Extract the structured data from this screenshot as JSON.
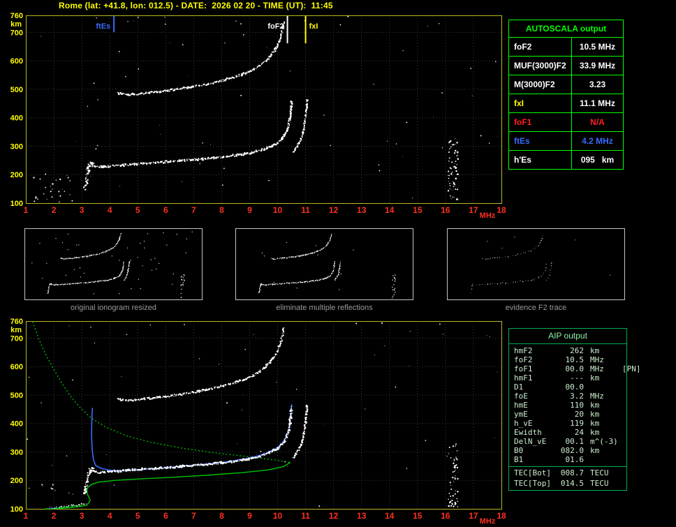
{
  "title": "Rome (lat: +41.8, lon: 012.5) - DATE:  2026 02 20 - TIME (UT):  11:45",
  "colors": {
    "background": "#000000",
    "frame": "#b9b920",
    "grid": "#3c3c3c",
    "x_label": "#ff3020",
    "y_label": "#ffff00",
    "trace": "#ffffff",
    "profile_green": "#00c400",
    "fit_blue": "#3b6bff",
    "es_green": "#00dd44",
    "table_green": "#00ff00",
    "aip_border": "#00b050",
    "aip_text": "#cdeccd",
    "caption_gray": "#9a9a9a",
    "red": "#ff2020",
    "yellow": "#ffff00"
  },
  "axis": {
    "x_ticks": [
      1,
      2,
      3,
      4,
      5,
      6,
      7,
      8,
      9,
      10,
      11,
      12,
      13,
      14,
      15,
      16,
      17,
      18
    ],
    "y_ticks": [
      760,
      700,
      600,
      500,
      400,
      300,
      200,
      100
    ],
    "x_unit": "MHz",
    "y_unit": "km"
  },
  "autoscala": {
    "title": "AUTOSCALA output",
    "rows": [
      {
        "label": "foF2",
        "value": "10.5 MHz",
        "label_color": "#ffffff",
        "value_color": "#ffffff"
      },
      {
        "label": "MUF(3000)F2",
        "value": "33.9 MHz",
        "label_color": "#ffffff",
        "value_color": "#ffffff"
      },
      {
        "label": "M(3000)F2",
        "value": "3.23",
        "label_color": "#ffffff",
        "value_color": "#ffffff"
      },
      {
        "label": "fxI",
        "value": "11.1 MHz",
        "label_color": "#ffff00",
        "value_color": "#ffffff"
      },
      {
        "label": "foF1",
        "value": "N/A",
        "label_color": "#ff2020",
        "value_color": "#ff2020"
      },
      {
        "label": "ftEs",
        "value": "4.2 MHz",
        "label_color": "#3b6bff",
        "value_color": "#3b6bff"
      },
      {
        "label": "h'Es",
        "value": "095   km",
        "label_color": "#ffffff",
        "value_color": "#ffffff"
      }
    ]
  },
  "aip": {
    "title": "AIP output",
    "rows": [
      {
        "label": "hmF2",
        "value": "262",
        "unit": "km",
        "extra": ""
      },
      {
        "label": "foF2",
        "value": "10.5",
        "unit": "MHz",
        "extra": ""
      },
      {
        "label": "foF1",
        "value": "00.0",
        "unit": "MHz",
        "extra": "[PN]"
      },
      {
        "label": "hmF1",
        "value": "---",
        "unit": "km",
        "extra": ""
      },
      {
        "label": "D1",
        "value": "00.0",
        "unit": "",
        "extra": ""
      },
      {
        "label": "foE",
        "value": "3.2",
        "unit": "MHz",
        "extra": ""
      },
      {
        "label": "hmE",
        "value": "110",
        "unit": "km",
        "extra": ""
      },
      {
        "label": "ymE",
        "value": "20",
        "unit": "km",
        "extra": ""
      },
      {
        "label": "h_vE",
        "value": "119",
        "unit": "km",
        "extra": ""
      },
      {
        "label": "Ewidth",
        "value": "24",
        "unit": "km",
        "extra": ""
      },
      {
        "label": "DelN_vE",
        "value": "00.1",
        "unit": "m^(-3)",
        "extra": ""
      },
      {
        "label": "B0",
        "value": "082.0",
        "unit": "km",
        "extra": ""
      },
      {
        "label": "B1",
        "value": "01.6",
        "unit": "",
        "extra": ""
      },
      {
        "label": "TEC[Bot]",
        "value": "008.7",
        "unit": "TECU",
        "extra": "",
        "sep": true
      },
      {
        "label": "TEC[Top]",
        "value": "014.5",
        "unit": "TECU",
        "extra": ""
      }
    ]
  },
  "thumbs": [
    {
      "caption": "original ionogram resized",
      "noise_specks": 45,
      "band": true,
      "step": 1.7,
      "passes": 2,
      "color": "#ffffff"
    },
    {
      "caption": "eliminate multiple reflections",
      "noise_specks": 10,
      "band": true,
      "step": 1.7,
      "passes": 2,
      "color": "#ffffff"
    },
    {
      "caption": "evidence F2 trace",
      "noise_specks": 6,
      "band": false,
      "step": 3.4,
      "passes": 1,
      "color": "#b9b9b9"
    }
  ],
  "markers": [
    {
      "f": 4.15,
      "len": 24,
      "side": "left",
      "label": "ftEs",
      "color": "#3b6bff"
    },
    {
      "f": 10.35,
      "len": 40,
      "side": "left",
      "label": "foF2",
      "color": "#ffffff"
    },
    {
      "f": 11.0,
      "len": 40,
      "side": "right",
      "label": "fxI",
      "color": "#ffff00"
    }
  ],
  "traces": {
    "hop1": [
      [
        3.3,
        232
      ],
      [
        3.6,
        228
      ],
      [
        4,
        230
      ],
      [
        4.5,
        234
      ],
      [
        5,
        238
      ],
      [
        5.5,
        241
      ],
      [
        6,
        245
      ],
      [
        6.5,
        249
      ],
      [
        7,
        253
      ],
      [
        7.5,
        257
      ],
      [
        8,
        262
      ],
      [
        8.5,
        268
      ],
      [
        9,
        276
      ],
      [
        9.4,
        286
      ],
      [
        9.7,
        297
      ],
      [
        10,
        312
      ],
      [
        10.15,
        326
      ],
      [
        10.28,
        344
      ],
      [
        10.38,
        368
      ],
      [
        10.44,
        398
      ],
      [
        10.48,
        432
      ],
      [
        10.5,
        462
      ]
    ],
    "cusp": [
      [
        3.12,
        152
      ],
      [
        3.18,
        185
      ],
      [
        3.22,
        215
      ],
      [
        3.3,
        242
      ],
      [
        3.5,
        236
      ]
    ],
    "hop2": [
      [
        4.3,
        487
      ],
      [
        4.6,
        480
      ],
      [
        5,
        484
      ],
      [
        5.5,
        489
      ],
      [
        6,
        495
      ],
      [
        6.5,
        502
      ],
      [
        7,
        510
      ],
      [
        7.5,
        519
      ],
      [
        8,
        530
      ],
      [
        8.5,
        544
      ],
      [
        9,
        562
      ],
      [
        9.4,
        585
      ],
      [
        9.7,
        612
      ],
      [
        9.95,
        645
      ],
      [
        10.1,
        680
      ],
      [
        10.18,
        712
      ],
      [
        10.24,
        740
      ]
    ],
    "xmode": [
      [
        10.55,
        278
      ],
      [
        10.7,
        298
      ],
      [
        10.85,
        328
      ],
      [
        10.95,
        368
      ],
      [
        11.02,
        418
      ],
      [
        11.06,
        468
      ]
    ],
    "profile_top": [
      [
        1.25,
        758
      ],
      [
        1.45,
        700
      ],
      [
        1.7,
        645
      ],
      [
        2,
        590
      ],
      [
        2.3,
        540
      ],
      [
        2.6,
        495
      ],
      [
        2.95,
        455
      ],
      [
        3.35,
        418
      ],
      [
        3.9,
        385
      ],
      [
        4.6,
        357
      ],
      [
        5.5,
        333
      ],
      [
        6.6,
        313
      ],
      [
        7.8,
        296
      ],
      [
        9,
        283
      ],
      [
        9.9,
        272
      ],
      [
        10.45,
        263
      ]
    ],
    "profile_bottom": [
      [
        10.45,
        263
      ],
      [
        10.2,
        248
      ],
      [
        9.6,
        236
      ],
      [
        8.7,
        227
      ],
      [
        7.6,
        219
      ],
      [
        6.4,
        212
      ],
      [
        5.2,
        206
      ],
      [
        4.2,
        200
      ],
      [
        3.6,
        194
      ],
      [
        3.35,
        186
      ],
      [
        3.22,
        176
      ],
      [
        3.18,
        165
      ],
      [
        3.2,
        152
      ],
      [
        3.26,
        140
      ],
      [
        3.3,
        130
      ],
      [
        3.24,
        120
      ],
      [
        3.18,
        113
      ],
      [
        2.9,
        108
      ],
      [
        2.5,
        104
      ],
      [
        2.1,
        101
      ],
      [
        1.7,
        100
      ]
    ],
    "blue_fit": [
      [
        3.38,
        455
      ],
      [
        3.36,
        410
      ],
      [
        3.35,
        360
      ],
      [
        3.37,
        310
      ],
      [
        3.42,
        272
      ],
      [
        3.5,
        252
      ],
      [
        3.7,
        242
      ],
      [
        4,
        236
      ],
      [
        4.5,
        234
      ],
      [
        5,
        237
      ],
      [
        5.5,
        241
      ],
      [
        6,
        245
      ],
      [
        6.5,
        249
      ],
      [
        7,
        253
      ],
      [
        7.5,
        258
      ],
      [
        8,
        263
      ],
      [
        8.5,
        270
      ],
      [
        9,
        279
      ],
      [
        9.4,
        289
      ],
      [
        9.7,
        301
      ],
      [
        10,
        316
      ],
      [
        10.15,
        330
      ],
      [
        10.28,
        348
      ],
      [
        10.38,
        372
      ],
      [
        10.44,
        402
      ],
      [
        10.48,
        436
      ],
      [
        10.5,
        468
      ]
    ],
    "e_white": [
      [
        2.05,
        104
      ],
      [
        2.3,
        107
      ],
      [
        2.55,
        110
      ],
      [
        2.8,
        113
      ],
      [
        3.05,
        116
      ],
      [
        3.25,
        119
      ]
    ],
    "e_green": [
      [
        2.1,
        102
      ],
      [
        2.35,
        105
      ],
      [
        2.6,
        108
      ],
      [
        2.85,
        111
      ],
      [
        3.1,
        114
      ]
    ],
    "e_blue": [
      [
        1.85,
        101
      ],
      [
        2,
        103
      ],
      [
        2.15,
        105
      ]
    ]
  },
  "noise": {
    "top": [
      {
        "x": [
          16.1,
          16.45
        ],
        "y": [
          100,
          330
        ],
        "n": 70,
        "r": 1.1
      },
      {
        "x": [
          1.1,
          2.7
        ],
        "y": [
          100,
          205
        ],
        "n": 26,
        "r": 1.0
      },
      {
        "x": [
          1.05,
          17.9
        ],
        "y": [
          105,
          755
        ],
        "n": 55,
        "r": 0.8
      },
      {
        "x": [
          2,
          17.5
        ],
        "y": [
          728,
          758
        ],
        "n": 9,
        "r": 0.9
      }
    ],
    "bottom": [
      {
        "x": [
          16.1,
          16.45
        ],
        "y": [
          100,
          330
        ],
        "n": 60,
        "r": 1.1
      },
      {
        "x": [
          1.1,
          2.7
        ],
        "y": [
          100,
          200
        ],
        "n": 12,
        "r": 0.9
      },
      {
        "x": [
          1.05,
          17.9
        ],
        "y": [
          105,
          750
        ],
        "n": 42,
        "r": 0.8
      },
      {
        "x": [
          2.5,
          17.5
        ],
        "y": [
          728,
          756
        ],
        "n": 6,
        "r": 0.9
      }
    ],
    "thumb_band": {
      "x": [
        16.1,
        16.45
      ],
      "y": [
        100,
        330
      ],
      "n": 18,
      "r": 0.7
    },
    "thumb_specks": {
      "x": [
        1.05,
        17.9
      ],
      "y": [
        105,
        750
      ],
      "r": 0.6
    }
  }
}
